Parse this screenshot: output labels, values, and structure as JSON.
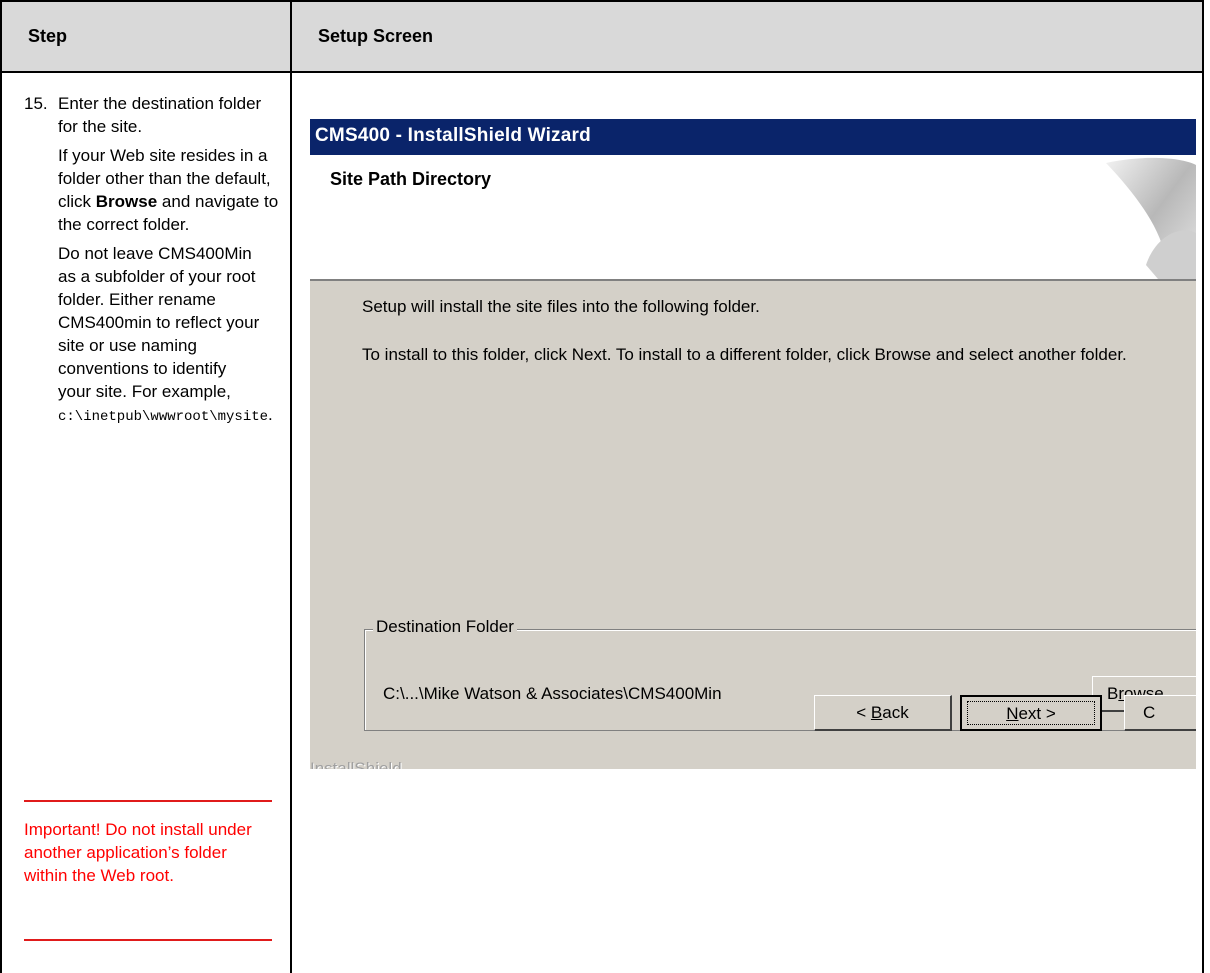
{
  "table": {
    "header_step": "Step",
    "header_setup": "Setup Screen"
  },
  "step": {
    "number": "15.",
    "intro": "Enter the destination folder for the site.",
    "p2_before": "If your Web site resides in a folder other than the default, click ",
    "p2_bold": "Browse",
    "p2_after": " and navigate to the correct folder.",
    "p3_text": "Do not leave CMS400Min as a subfolder of your root folder. Either rename CMS400min to reflect your site or use naming conventions to identify your site. For example, ",
    "p3_code": "c:\\inetpub\\wwwroot\\mysite",
    "p3_end": ".",
    "important": "Important! Do not install under another application’s folder within the Web root."
  },
  "dialog": {
    "title": "CMS400 - InstallShield Wizard",
    "banner_title": "Site Path Directory",
    "line1": "Setup will install the site files into the following folder.",
    "line2": "To install to this folder, click Next. To install to a different folder, click Browse and select another folder.",
    "group_label": "Destination Folder",
    "dest_path": "C:\\...\\Mike Watson & Associates\\CMS400Min",
    "browse_pre": "B",
    "browse_u": "r",
    "browse_post": "owse",
    "footer_brand": "InstallShield",
    "back_pre": "< ",
    "back_u": "B",
    "back_post": "ack",
    "next_u": "N",
    "next_post": "ext >",
    "cancel_label": "C"
  },
  "colors": {
    "title_bar": "#0a246a",
    "dialog_face": "#d4d0c8",
    "header_fill": "#d9d9d9",
    "important_text": "#ff0000"
  }
}
